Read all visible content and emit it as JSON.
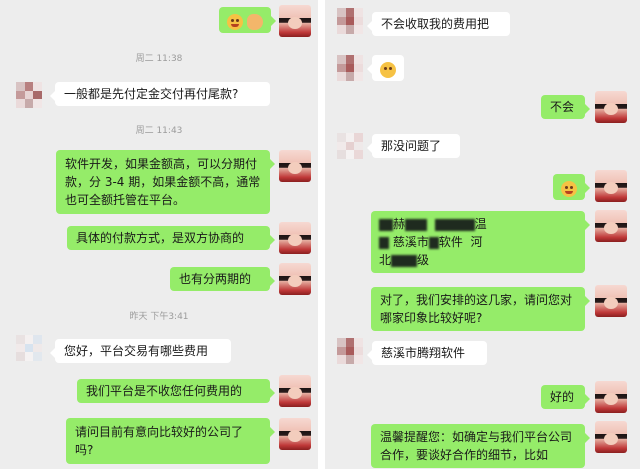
{
  "left": {
    "timestamps": [
      "周二 11:38",
      "周二 11:43",
      "昨天 下午3:41"
    ],
    "messages": [
      {
        "from": "self",
        "text": ""
      },
      {
        "from": "other",
        "text": "一般都是先付定金交付再付尾款?"
      },
      {
        "from": "self",
        "text": "软件开发，如果金额高，可以分期付款，分 3-4 期，如果金额不高，通常也可全额托管在平台。"
      },
      {
        "from": "self",
        "text": "具体的付款方式，是双方协商的"
      },
      {
        "from": "self",
        "text": "也有分两期的"
      },
      {
        "from": "other",
        "text": "您好，平台交易有哪些费用"
      },
      {
        "from": "self",
        "text": "我们平台是不收您任何费用的"
      },
      {
        "from": "self",
        "text": "请问目前有意向比较好的公司了吗?"
      }
    ]
  },
  "right": {
    "messages": [
      {
        "from": "other",
        "text": "不会收取我的费用把"
      },
      {
        "from": "other",
        "text": ""
      },
      {
        "from": "self",
        "text": "不会"
      },
      {
        "from": "other",
        "text": "那没问题了"
      },
      {
        "from": "self",
        "text": ""
      },
      {
        "from": "self",
        "text_parts": [
          "赫",
          "温",
          "慈溪市",
          "软件",
          "河",
          "北",
          "级"
        ]
      },
      {
        "from": "self",
        "text": "对了，我们安排的这几家，请问您对哪家印象比较好呢?"
      },
      {
        "from": "other",
        "text": "慈溪市腾翔软件"
      },
      {
        "from": "self",
        "text": "好的"
      },
      {
        "from": "self",
        "text": "温馨提醒您：如确定与我们平台公司合作，要谈好合作的细节，比如"
      }
    ]
  },
  "icons": {
    "emoji_smile": "smile-emoji-icon",
    "emoji_handshake": "handshake-emoji-icon",
    "emoji_thinking": "thinking-emoji-icon"
  },
  "colors": {
    "background": "#ededed",
    "bubble_self": "#95ec69",
    "bubble_other": "#ffffff"
  }
}
